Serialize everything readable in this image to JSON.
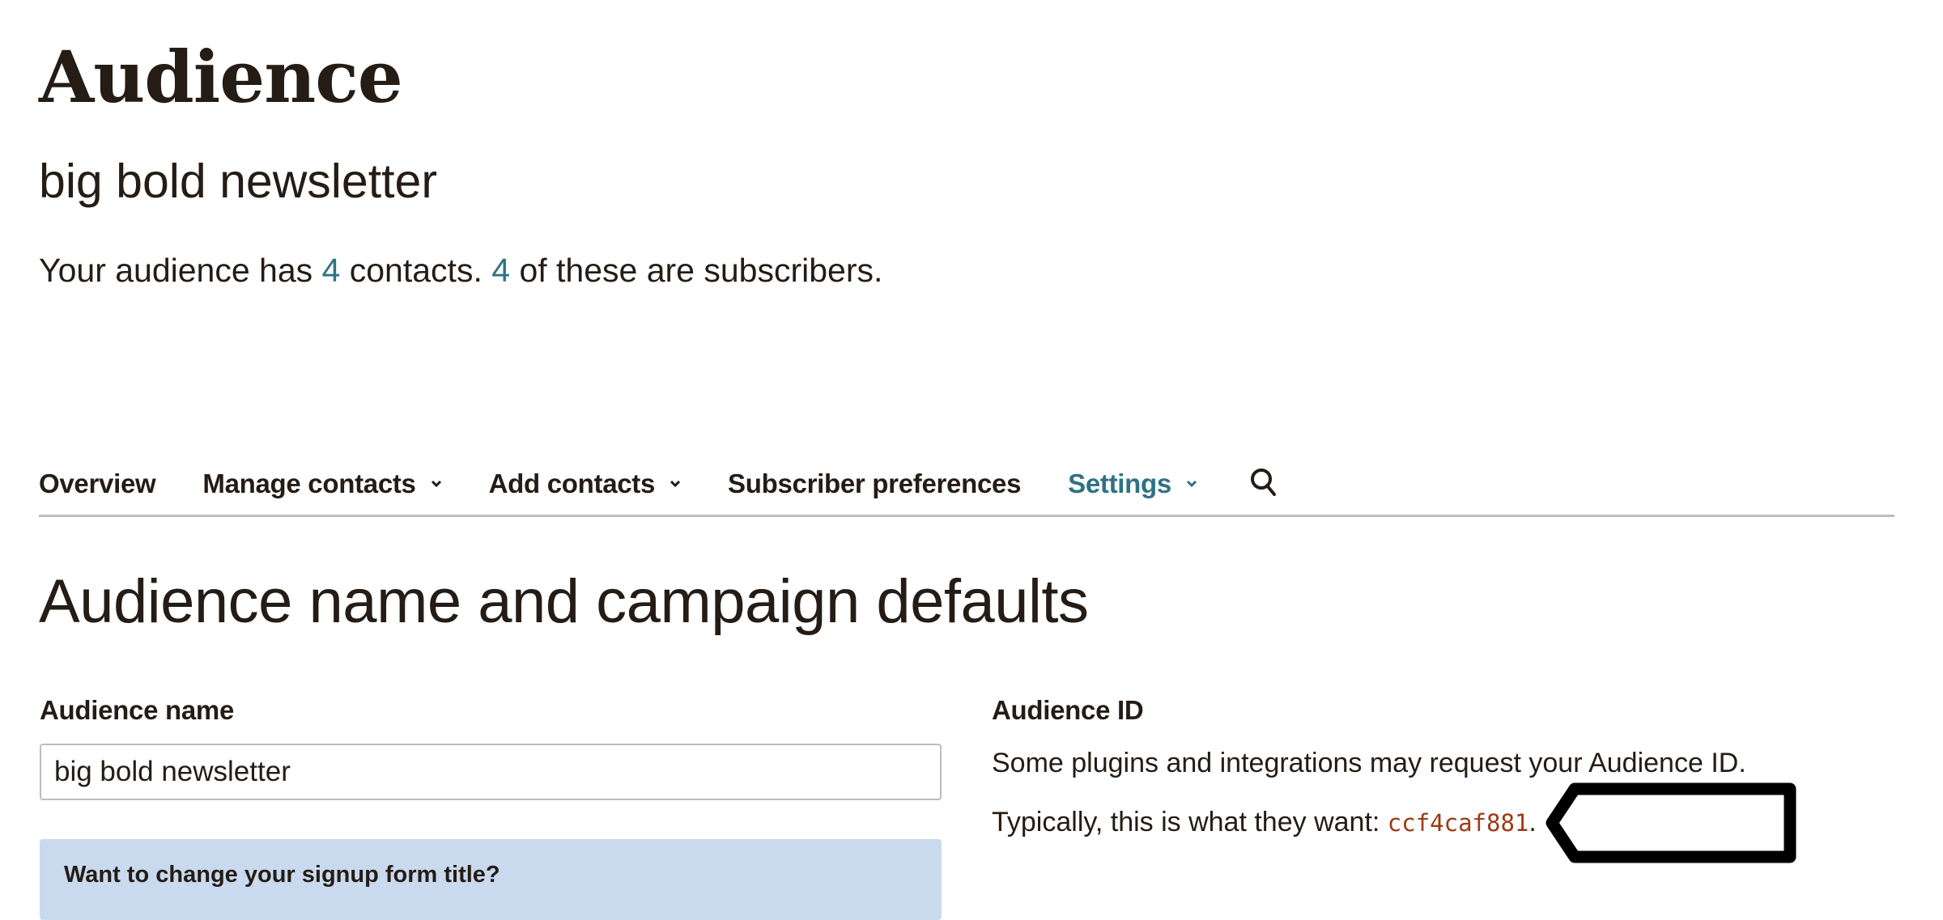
{
  "header": {
    "title": "Audience",
    "audience_name": "big bold newsletter",
    "summary": {
      "prefix": "Your audience has ",
      "contacts_count": "4",
      "middle": " contacts. ",
      "subscribers_count": "4",
      "suffix": " of these are subscribers."
    }
  },
  "nav": {
    "items": [
      {
        "label": "Overview",
        "has_dropdown": false,
        "active": false
      },
      {
        "label": "Manage contacts",
        "has_dropdown": true,
        "active": false
      },
      {
        "label": "Add contacts",
        "has_dropdown": true,
        "active": false
      },
      {
        "label": "Subscriber preferences",
        "has_dropdown": false,
        "active": false
      },
      {
        "label": "Settings",
        "has_dropdown": true,
        "active": true
      }
    ],
    "search_icon": "search-icon"
  },
  "section": {
    "heading": "Audience name and campaign defaults",
    "audience_name_field": {
      "label": "Audience name",
      "value": "big bold newsletter"
    },
    "info_box": {
      "title": "Want to change your signup form title?",
      "body": ""
    },
    "audience_id": {
      "label": "Audience ID",
      "description": "Some plugins and integrations may request your Audience ID.",
      "typical_prefix": "Typically, this is what they want: ",
      "id_value": "ccf4caf881",
      "typical_suffix": "."
    }
  },
  "colors": {
    "accent": "#2f7284",
    "text": "#241c15",
    "info_box_bg": "#c9daef",
    "code": "#9c3a14",
    "divider": "#bdbdbd"
  }
}
